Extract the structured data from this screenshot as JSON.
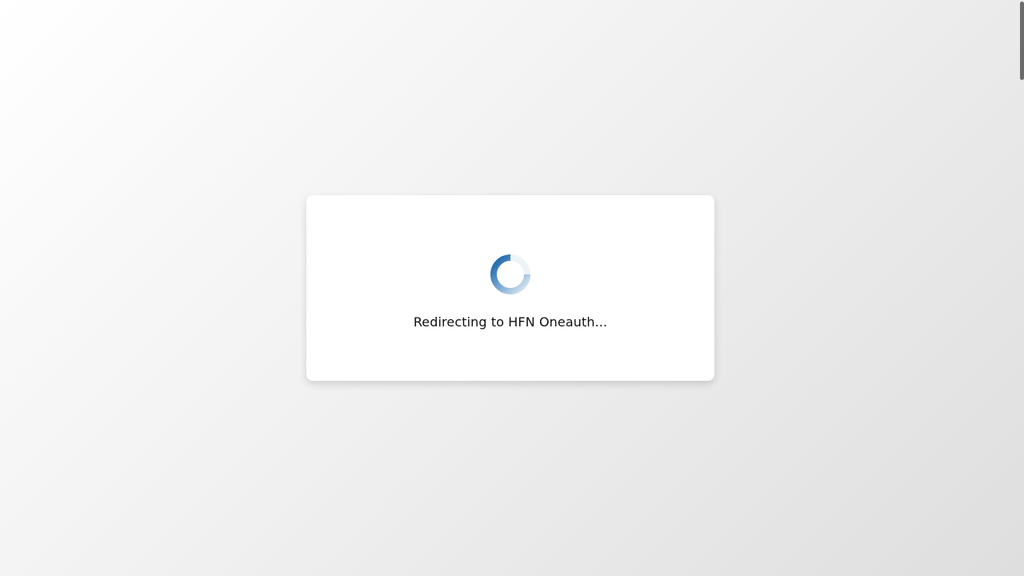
{
  "loading": {
    "message": "Redirecting to HFN Oneauth...",
    "spinner_icon": "loading-spinner-icon",
    "spinner_color": "#1f68a8"
  },
  "colors": {
    "background_light": "#ffffff",
    "background_dark": "#dedede",
    "card": "#ffffff",
    "scrollbar": "#6b6b6b"
  }
}
